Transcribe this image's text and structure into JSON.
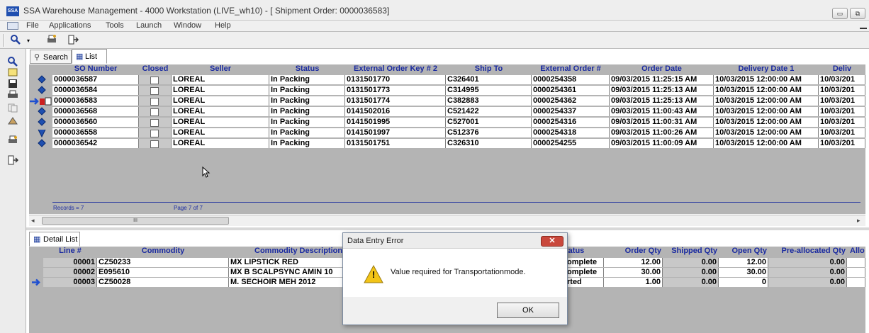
{
  "window": {
    "app_icon_text": "SSA",
    "title": "SSA Warehouse Management - 4000 Workstation (LIVE_wh10) - [ Shipment Order: 0000036583]",
    "minimize_label": "▭",
    "restore_label": "⧉"
  },
  "menubar": {
    "items": [
      "File",
      "Applications",
      "Tools",
      "Launch",
      "Window",
      "Help"
    ]
  },
  "upper": {
    "tabs": [
      "Search",
      "List"
    ],
    "columns": [
      "SO Number",
      "Closed",
      "Seller",
      "Status",
      "External Order Key # 2",
      "Ship To",
      "External Order #",
      "Order Date",
      "Delivery Date 1",
      "Deliv"
    ],
    "rows": [
      {
        "icon": "diamond",
        "so": "0000036587",
        "seller": "LOREAL",
        "status": "In Packing",
        "ext2": "0131501770",
        "ship_to": "C326401",
        "ext": "0000254358",
        "order_date": "09/03/2015 11:25:15 AM",
        "delivery": "10/03/2015 12:00:00 AM",
        "deliv": "10/03/201"
      },
      {
        "icon": "diamond",
        "so": "0000036584",
        "seller": "LOREAL",
        "status": "In Packing",
        "ext2": "0131501773",
        "ship_to": "C314995",
        "ext": "0000254361",
        "order_date": "09/03/2015 11:25:13 AM",
        "delivery": "10/03/2015 12:00:00 AM",
        "deliv": "10/03/201"
      },
      {
        "icon": "current",
        "so": "0000036583",
        "seller": "LOREAL",
        "status": "In Packing",
        "ext2": "0131501774",
        "ship_to": "C382883",
        "ext": "0000254362",
        "order_date": "09/03/2015 11:25:13 AM",
        "delivery": "10/03/2015 12:00:00 AM",
        "deliv": "10/03/201"
      },
      {
        "icon": "diamond",
        "so": "0000036568",
        "seller": "LOREAL",
        "status": "In Packing",
        "ext2": "0141502016",
        "ship_to": "C521422",
        "ext": "0000254337",
        "order_date": "09/03/2015 11:00:43 AM",
        "delivery": "10/03/2015 12:00:00 AM",
        "deliv": "10/03/201"
      },
      {
        "icon": "diamond",
        "so": "0000036560",
        "seller": "LOREAL",
        "status": "In Packing",
        "ext2": "0141501995",
        "ship_to": "C527001",
        "ext": "0000254316",
        "order_date": "09/03/2015 11:00:31 AM",
        "delivery": "10/03/2015 12:00:00 AM",
        "deliv": "10/03/201"
      },
      {
        "icon": "check",
        "so": "0000036558",
        "seller": "LOREAL",
        "status": "In Packing",
        "ext2": "0141501997",
        "ship_to": "C512376",
        "ext": "0000254318",
        "order_date": "09/03/2015 11:00:26 AM",
        "delivery": "10/03/2015 12:00:00 AM",
        "deliv": "10/03/201"
      },
      {
        "icon": "diamond",
        "so": "0000036542",
        "seller": "LOREAL",
        "status": "In Packing",
        "ext2": "0131501751",
        "ship_to": "C326310",
        "ext": "0000254255",
        "order_date": "09/03/2015 11:00:09 AM",
        "delivery": "10/03/2015 12:00:00 AM",
        "deliv": "10/03/201"
      }
    ],
    "records_label": "Records = 7",
    "page_label": "Page 7 of 7",
    "scroll_thumb_glyph": "III"
  },
  "lower": {
    "tabs": [
      "Detail List"
    ],
    "columns": [
      "Line #",
      "Commodity",
      "Commodity Description",
      "tatus",
      "Order Qty",
      "Shipped Qty",
      "Open Qty",
      "Pre-allocated Qty",
      "Allo"
    ],
    "rows": [
      {
        "marker": "",
        "line": "00001",
        "commodity": "CZ50233",
        "desc": "MX LIPSTICK RED",
        "status": "omplete",
        "order_qty": "12.00",
        "shipped": "0.00",
        "open": "12.00",
        "prealloc": "0.00"
      },
      {
        "marker": "",
        "line": "00002",
        "commodity": "E095610",
        "desc": "MX B SCALPSYNC AMIN 10",
        "status": "omplete",
        "order_qty": "30.00",
        "shipped": "0.00",
        "open": "30.00",
        "prealloc": "0.00"
      },
      {
        "marker": "arrow",
        "line": "00003",
        "commodity": "CZ50028",
        "desc": "M. SECHOIR MEH 2012",
        "status": "rted",
        "order_qty": "1.00",
        "shipped": "0.00",
        "open": "0",
        "prealloc": "0.00"
      }
    ]
  },
  "dialog": {
    "title": "Data Entry Error",
    "close_label": "✕",
    "warning_glyph": "!",
    "message": "Value required for Transportationmode.",
    "ok_label": "OK"
  },
  "colors": {
    "header_text": "#1a2aa0",
    "row_icon": "#1f4fb0",
    "arrow": "#1f4fd0",
    "warning": "#f2c417"
  }
}
